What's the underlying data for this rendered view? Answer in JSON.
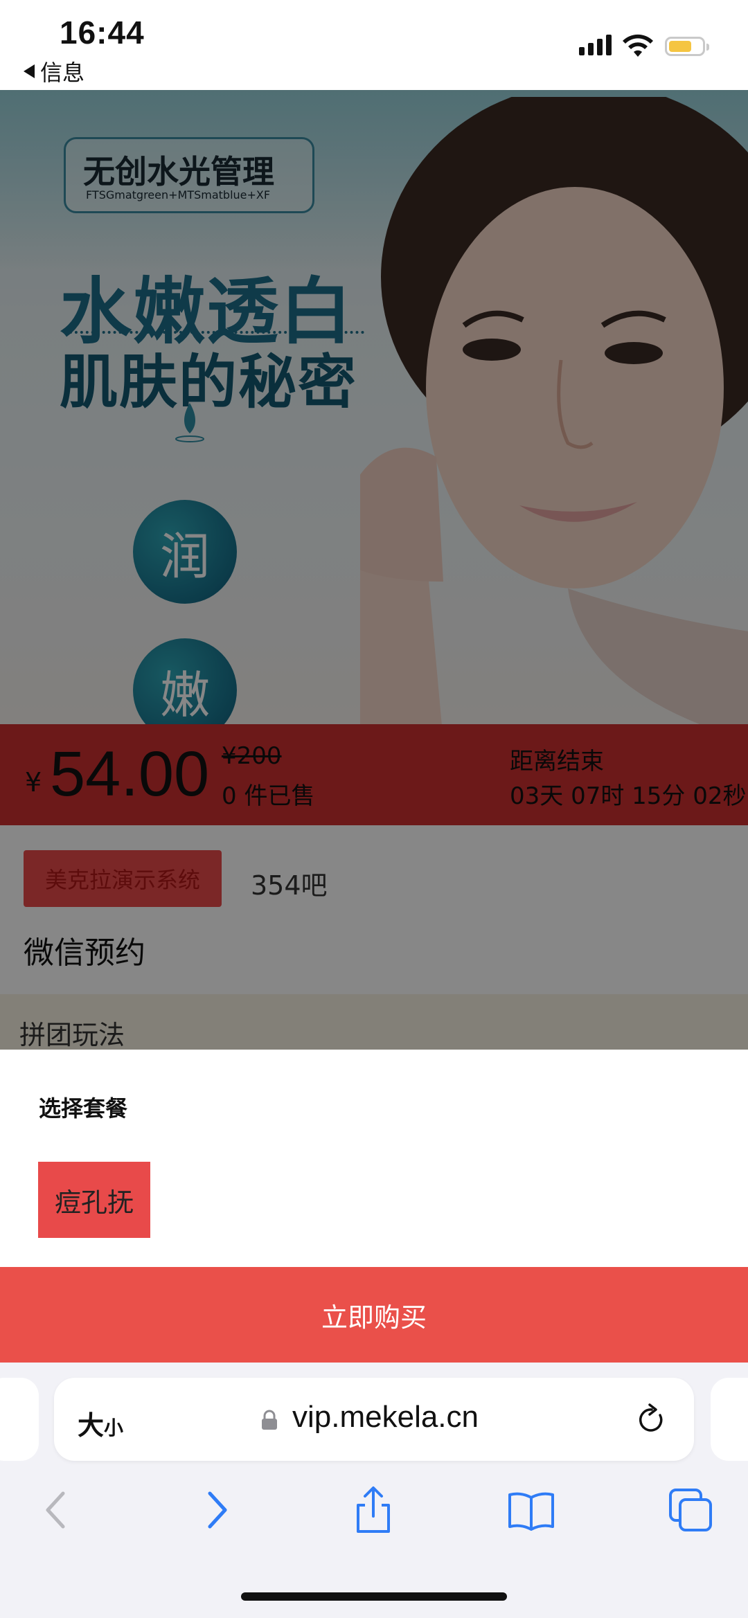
{
  "status_bar": {
    "time": "16:44",
    "back_app": "信息"
  },
  "hero": {
    "logo_title": "无创水光管理",
    "logo_subtitle": "FTSGmatgreen+MTSmatblue+XF",
    "headline_line1": "水嫩透白",
    "headline_line2": "肌肤的秘密",
    "circle_1": "润",
    "circle_2": "嫩"
  },
  "price_bar": {
    "currency": "¥",
    "price": "54.00",
    "original_price": "¥200",
    "sold_count": "0 件已售",
    "countdown_label": "距离结束",
    "countdown": "03天 07时 15分 02秒"
  },
  "content": {
    "shop_tag": "美克拉演示系统",
    "shop_name": "354吧",
    "booking": "微信预约",
    "group_buy_label": "拼团玩法"
  },
  "sheet": {
    "title": "选择套餐",
    "options": [
      "痘孔抚"
    ],
    "buy_button": "立即购买"
  },
  "safari": {
    "text_size_big": "大",
    "text_size_small": "小",
    "url": "vip.mekela.cn"
  },
  "colors": {
    "accent_red": "#ea504a",
    "price_bar_red": "#cc3030",
    "safari_blue": "#2f7cf6"
  }
}
